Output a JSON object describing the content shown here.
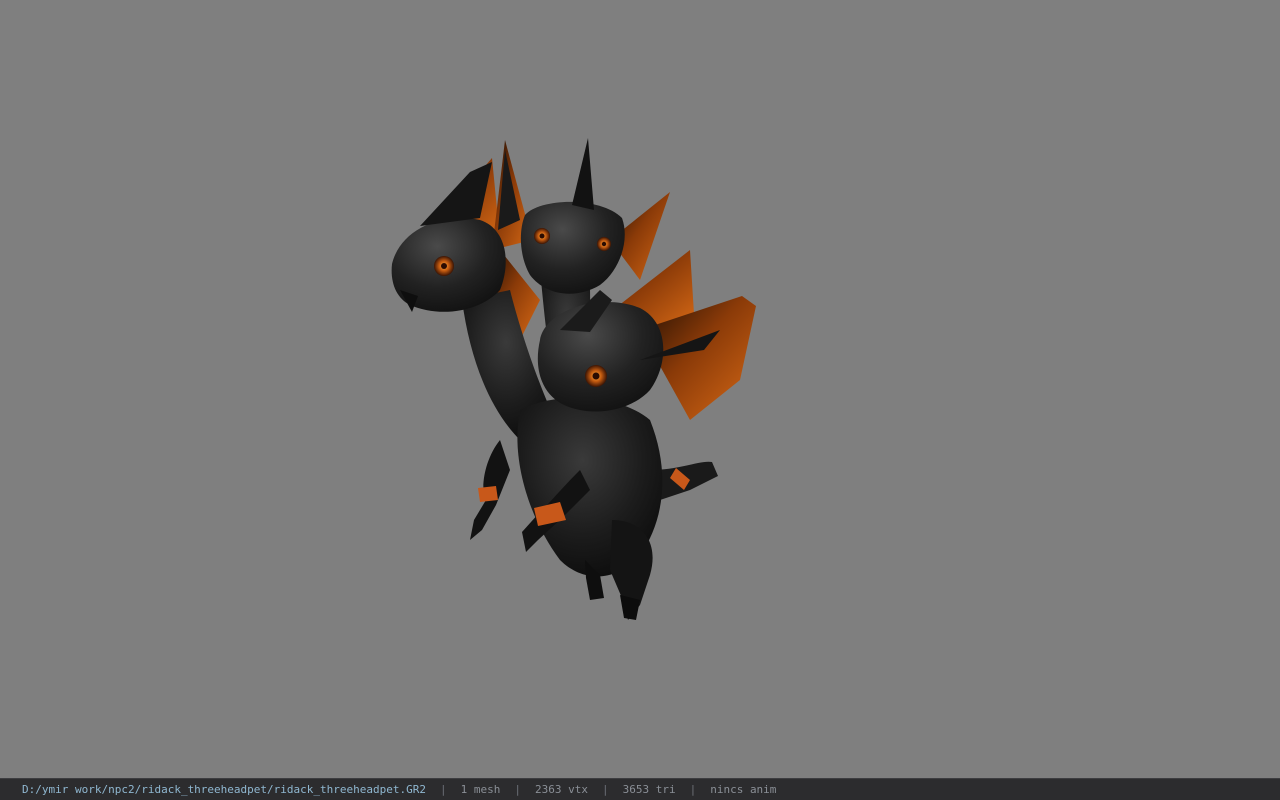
{
  "viewer": {
    "background_color": "#7f7f7f",
    "model_name": "ridack_threeheadpet"
  },
  "statusbar": {
    "file_path": "D:/ymir work/npc2/ridack_threeheadpet/ridack_threeheadpet.GR2",
    "separator": "|",
    "mesh_count": "1 mesh",
    "vertex_count": "2363 vtx",
    "triangle_count": "3653 tri",
    "anim_status": "nincs anim",
    "accent_color": "#8fb7d0"
  }
}
